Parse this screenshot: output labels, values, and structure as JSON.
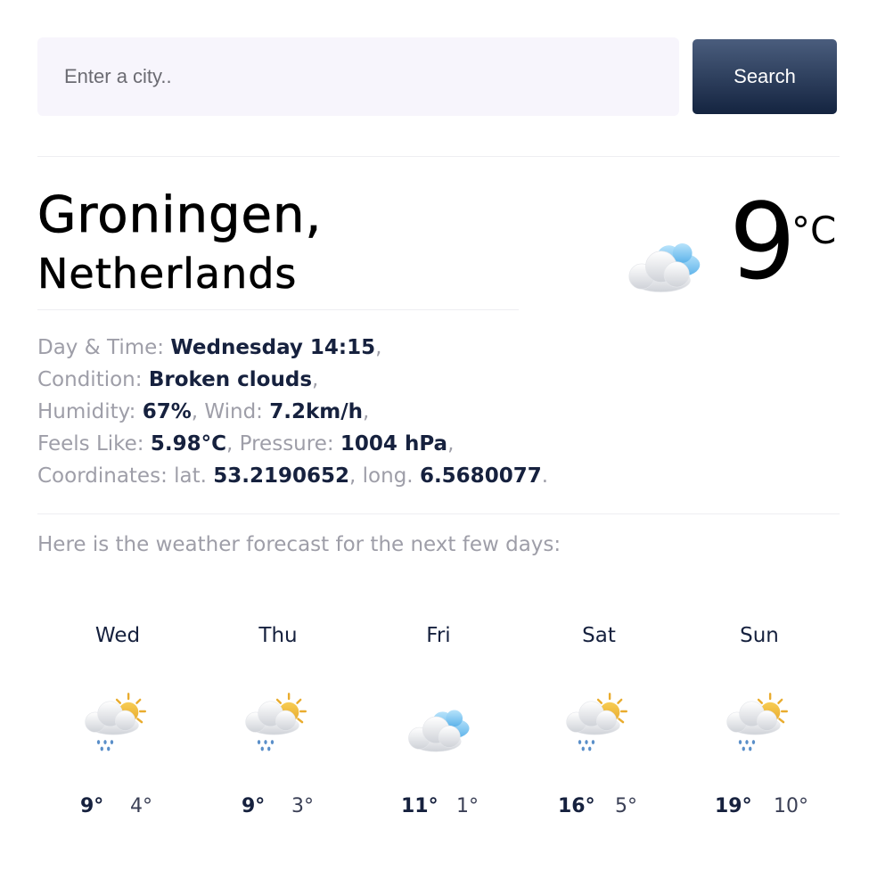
{
  "search": {
    "placeholder": "Enter a city..",
    "value": "",
    "button_label": "Search"
  },
  "location": {
    "city": "Groningen,",
    "country": "Netherlands"
  },
  "current": {
    "temperature": "9",
    "unit": "°C",
    "icon": "broken-clouds-icon"
  },
  "details": {
    "day_time_label": "Day & Time:",
    "day_time": "Wednesday 14:15",
    "condition_label": "Condition:",
    "condition": "Broken clouds",
    "humidity_label": "Humidity:",
    "humidity": "67%",
    "wind_label": "Wind:",
    "wind": "7.2km/h",
    "feels_like_label": "Feels Like:",
    "feels_like": "5.98°C",
    "pressure_label": "Pressure:",
    "pressure": "1004 hPa",
    "coordinates_label": "Coordinates: lat.",
    "lat": "53.2190652",
    "long_label": "long.",
    "long": "6.5680077"
  },
  "forecast_intro": "Here is the weather forecast for the next few days:",
  "forecast": [
    {
      "day": "Wed",
      "icon": "sun-cloud-rain-icon",
      "high": "9°",
      "low": "4°"
    },
    {
      "day": "Thu",
      "icon": "sun-cloud-rain-icon",
      "high": "9°",
      "low": "3°"
    },
    {
      "day": "Fri",
      "icon": "broken-clouds-icon",
      "high": "11°",
      "low": "1°"
    },
    {
      "day": "Sat",
      "icon": "sun-cloud-rain-icon",
      "high": "16°",
      "low": "5°"
    },
    {
      "day": "Sun",
      "icon": "sun-cloud-rain-icon",
      "high": "19°",
      "low": "10°"
    }
  ],
  "colors": {
    "accent": "#16213e",
    "muted": "#9e9ea8",
    "input_bg": "#f7f5fc"
  }
}
